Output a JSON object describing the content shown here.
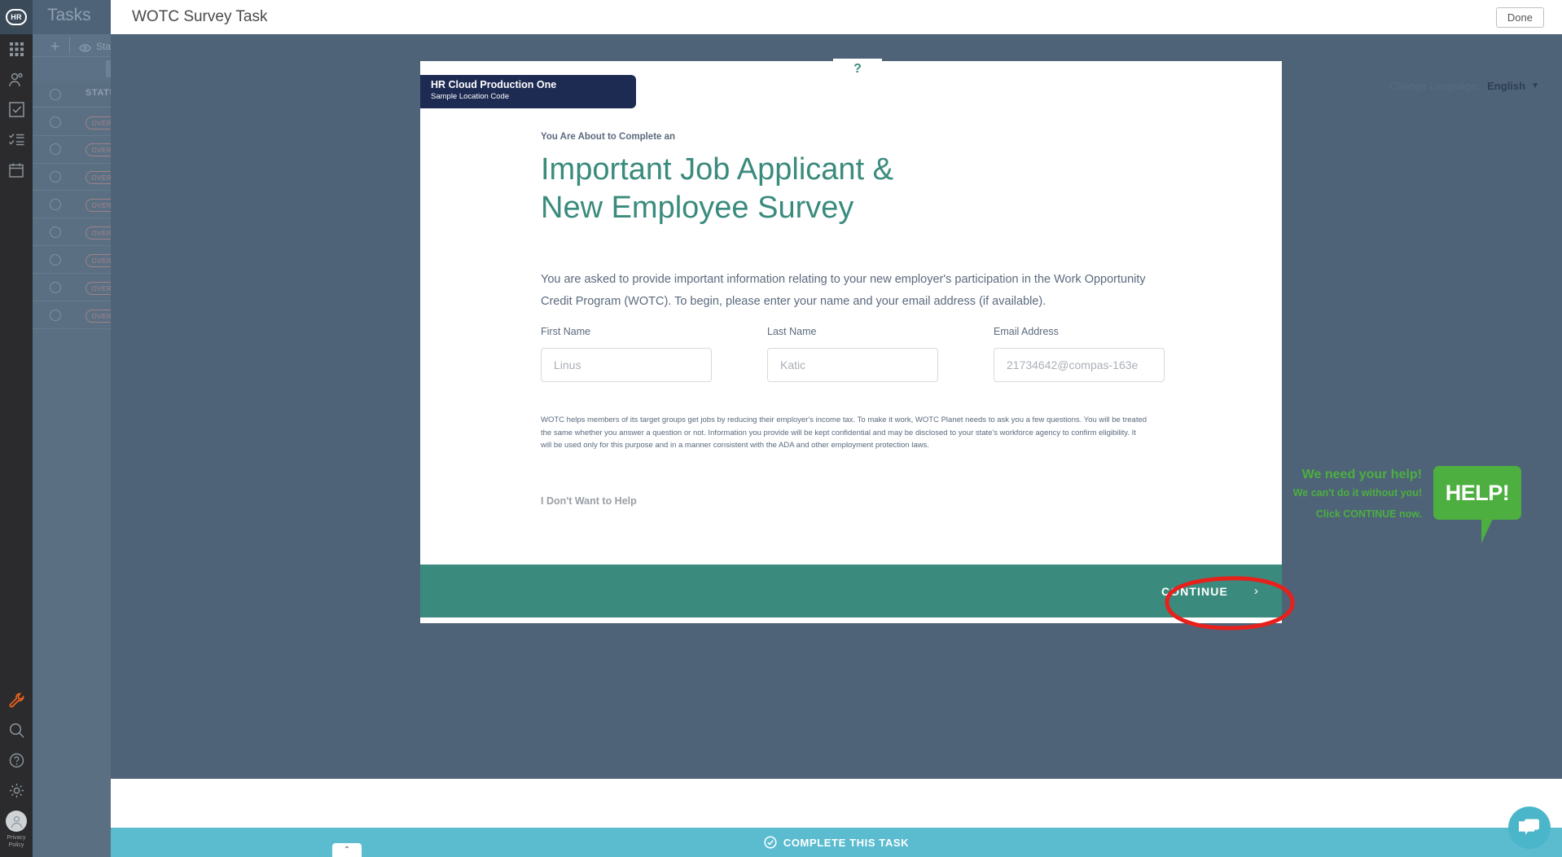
{
  "background_app": {
    "logo_text": "HR",
    "page_title": "Tasks",
    "toolbar": {
      "add_label": "+",
      "view_label": "Standard",
      "search_placeholder": "Sta..."
    },
    "table": {
      "columns": [
        "STATUS"
      ],
      "rows": [
        {
          "status": "OVERDUE"
        },
        {
          "status": "OVERDUE"
        },
        {
          "status": "OVERDUE"
        },
        {
          "status": "OVERDUE"
        },
        {
          "status": "OVERDUE"
        },
        {
          "status": "OVERDUE"
        },
        {
          "status": "OVERDUE"
        },
        {
          "status": "OVERDUE"
        }
      ]
    },
    "sidebar": {
      "items": [
        {
          "name": "apps-grid-icon"
        },
        {
          "name": "people-icon"
        },
        {
          "name": "checkbox-task-icon"
        },
        {
          "name": "checklist-icon"
        },
        {
          "name": "calendar-icon"
        }
      ],
      "bottom_items": [
        {
          "name": "wrench-icon"
        },
        {
          "name": "search-icon"
        },
        {
          "name": "help-circle-icon"
        },
        {
          "name": "gear-icon"
        }
      ],
      "privacy_label_line1": "Privacy",
      "privacy_label_line2": "Policy"
    }
  },
  "task_panel": {
    "title": "WOTC Survey Task",
    "done_label": "Done",
    "complete_task_label": "COMPLETE THIS TASK",
    "collapse_caret": "⌃"
  },
  "survey": {
    "help_tab_label": "?",
    "org_name": "HR Cloud Production One",
    "org_location": "Sample Location Code",
    "language": {
      "label": "Change Language:",
      "value": "English",
      "caret": "▼"
    },
    "kicker": "You Are About to Complete an",
    "headline_line1": "Important Job Applicant &",
    "headline_line2": "New Employee Survey",
    "intro": "You are asked to provide important information relating to your new employer's participation in the Work Opportunity Credit Program (WOTC). To begin, please enter your name and your email address (if available).",
    "fields": [
      {
        "label": "First Name",
        "value": "",
        "placeholder": "Linus",
        "name": "first-name"
      },
      {
        "label": "Last Name",
        "value": "",
        "placeholder": "Katic",
        "name": "last-name"
      },
      {
        "label": "Email Address",
        "value": "",
        "placeholder": "21734642@compas-163e",
        "name": "email-address"
      }
    ],
    "disclaimer": "WOTC helps members of its target groups get jobs by reducing their employer's income tax. To make it work, WOTC Planet needs to ask you a few questions. You will be treated the same whether you answer a question or not. Information you provide will be kept confidential and may be disclosed to your state's workforce agency to confirm eligibility. It will be used only for this purpose and in a manner consistent with the ADA and other employment protection laws.",
    "decline_label": "I Don't Want to Help",
    "help_promo": {
      "line1": "We need your help!",
      "line2": "We can't do it without you!",
      "line3": "Click CONTINUE now.",
      "bubble_text": "HELP!"
    },
    "continue_label": "CONTINUE",
    "continue_caret": "›"
  },
  "colors": {
    "teal_accent": "#3a8b7d",
    "navy_banner": "#1d2a52",
    "green_promo": "#4caf3f",
    "light_blue_bar": "#5bbcd0",
    "backdrop": "#4e6378",
    "annotation_red": "#e8201c"
  }
}
